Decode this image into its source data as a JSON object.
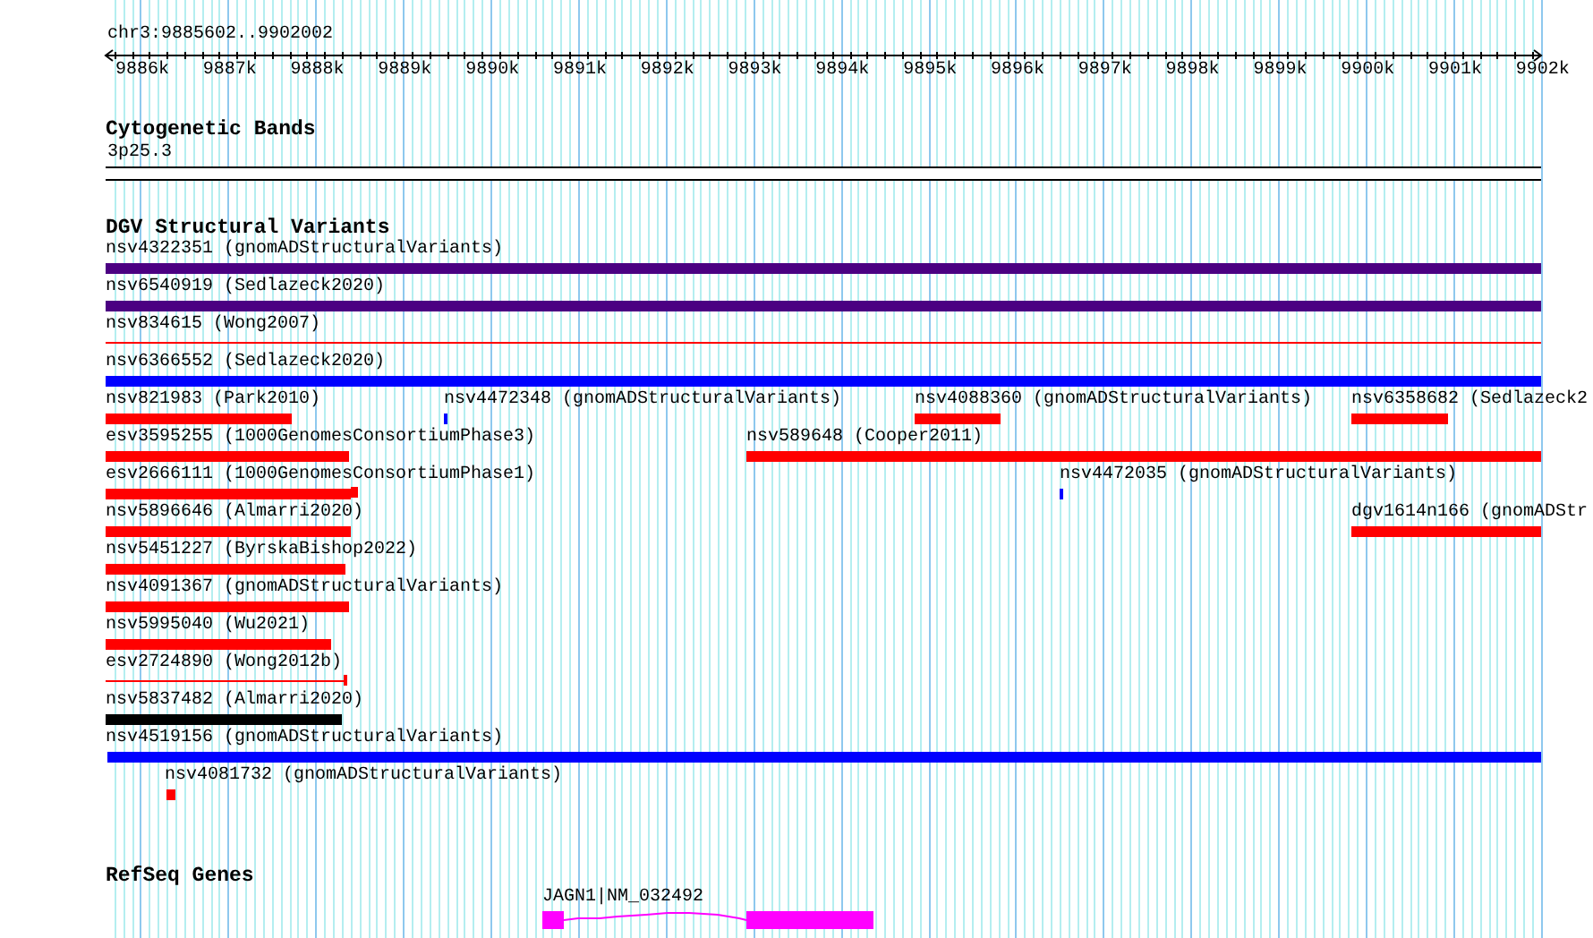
{
  "ruler": {
    "location": "chr3:9885602..9902002",
    "ticks": [
      "9886k",
      "9887k",
      "9888k",
      "9889k",
      "9890k",
      "9891k",
      "9892k",
      "9893k",
      "9894k",
      "9895k",
      "9896k",
      "9897k",
      "9898k",
      "9899k",
      "9900k",
      "9901k",
      "9902k"
    ]
  },
  "tracks": [
    {
      "title": "Cytogenetic Bands",
      "features": [
        {
          "label": "3p25.3",
          "kind": "band",
          "color": "#ffffff"
        }
      ]
    },
    {
      "title": "DGV Structural Variants",
      "features": [
        {
          "label": "nsv4322351 (gnomADStructuralVariants)",
          "kind": "bar",
          "color": "#4b0082"
        },
        {
          "label": "nsv6540919 (Sedlazeck2020)",
          "kind": "bar",
          "color": "#4b0082"
        },
        {
          "label": "nsv834615 (Wong2007)",
          "kind": "line",
          "color": "#ff0000"
        },
        {
          "label": "nsv6366552 (Sedlazeck2020)",
          "kind": "bar",
          "color": "#0000ff"
        },
        {
          "label": "nsv821983 (Park2010)",
          "kind": "bar",
          "color": "#ff0000"
        },
        {
          "label": "nsv4472348 (gnomADStructuralVariants)",
          "kind": "bar",
          "color": "#0000ff"
        },
        {
          "label": "nsv4088360 (gnomADStructuralVariants)",
          "kind": "bar",
          "color": "#ff0000"
        },
        {
          "label": "nsv6358682 (Sedlazeck2",
          "kind": "bar",
          "color": "#ff0000"
        },
        {
          "label": "esv3595255 (1000GenomesConsortiumPhase3)",
          "kind": "bar",
          "color": "#ff0000"
        },
        {
          "label": "nsv589648 (Cooper2011)",
          "kind": "bar",
          "color": "#ff0000"
        },
        {
          "label": "esv2666111 (1000GenomesConsortiumPhase1)",
          "kind": "bar",
          "color": "#ff0000"
        },
        {
          "label": "nsv4472035 (gnomADStructuralVariants)",
          "kind": "bar",
          "color": "#0000ff"
        },
        {
          "label": "nsv5896646 (Almarri2020)",
          "kind": "bar",
          "color": "#ff0000"
        },
        {
          "label": "dgv1614n166 (gnomADStr",
          "kind": "bar",
          "color": "#ff0000"
        },
        {
          "label": "nsv5451227 (ByrskaBishop2022)",
          "kind": "bar",
          "color": "#ff0000"
        },
        {
          "label": "nsv4091367 (gnomADStructuralVariants)",
          "kind": "bar",
          "color": "#ff0000"
        },
        {
          "label": "nsv5995040 (Wu2021)",
          "kind": "bar",
          "color": "#ff0000"
        },
        {
          "label": "esv2724890 (Wong2012b)",
          "kind": "line",
          "color": "#ff0000"
        },
        {
          "label": "nsv5837482 (Almarri2020)",
          "kind": "bar",
          "color": "#000000"
        },
        {
          "label": "nsv4519156 (gnomADStructuralVariants)",
          "kind": "bar",
          "color": "#0000ff"
        },
        {
          "label": "nsv4081732 (gnomADStructuralVariants)",
          "kind": "bar",
          "color": "#ff0000"
        }
      ]
    },
    {
      "title": "RefSeq Genes",
      "features": [
        {
          "label": "JAGN1|NM_032492",
          "kind": "gene",
          "color": "#ff00ff"
        }
      ]
    }
  ]
}
